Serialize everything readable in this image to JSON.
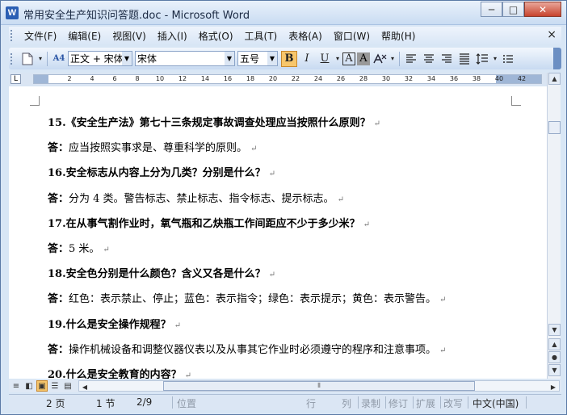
{
  "window": {
    "title": "常用安全生产知识问答题.doc - Microsoft Word",
    "icon_label": "W",
    "minimize": "─",
    "maximize": "□",
    "close": "✕"
  },
  "menu": {
    "items": [
      "文件(F)",
      "编辑(E)",
      "视图(V)",
      "插入(I)",
      "格式(O)",
      "工具(T)",
      "表格(A)",
      "窗口(W)",
      "帮助(H)"
    ],
    "close_doc": "×"
  },
  "toolbar": {
    "style_value": "正文 + 宋体",
    "font_value": "宋体",
    "size_value": "五号",
    "bold": "B",
    "italic": "I",
    "underline": "U",
    "style_icon": "A4",
    "char_border": "A",
    "char_shading": "A"
  },
  "ruler": {
    "corner": "L",
    "ticks": [
      "2",
      "4",
      "6",
      "8",
      "10",
      "12",
      "14",
      "16",
      "18",
      "20",
      "22",
      "24",
      "26",
      "28",
      "30",
      "32",
      "34",
      "36",
      "38",
      "40",
      "42"
    ]
  },
  "document": {
    "lines": [
      {
        "type": "q",
        "text": "15.《安全生产法》第七十三条规定事故调查处理应当按照什么原则？"
      },
      {
        "type": "a",
        "label": "答：",
        "text": "应当按照实事求是、尊重科学的原则。"
      },
      {
        "type": "q",
        "text": "16.安全标志从内容上分为几类？分别是什么？"
      },
      {
        "type": "a",
        "label": "答：",
        "text": "分为 4 类。警告标志、禁止标志、指令标志、提示标志。"
      },
      {
        "type": "q",
        "text": "17.在从事气割作业时，氧气瓶和乙炔瓶工作间距应不少于多少米？"
      },
      {
        "type": "a",
        "label": "答：",
        "text": "5 米。"
      },
      {
        "type": "q",
        "text": "18.安全色分别是什么颜色？含义又各是什么？"
      },
      {
        "type": "a",
        "label": "答：",
        "text": "红色：表示禁止、停止；蓝色：表示指令；绿色：表示提示；黄色：表示警告。"
      },
      {
        "type": "q",
        "text": "19.什么是安全操作规程？"
      },
      {
        "type": "a",
        "label": "答：",
        "text": "操作机械设备和调整仪器仪表以及从事其它作业时必须遵守的程序和注意事项。"
      },
      {
        "type": "q",
        "text": "20.什么是安全教育的内容？"
      }
    ],
    "paragraph_mark": "↵"
  },
  "status": {
    "page": "2 页",
    "section": "1 节",
    "page_of": "2/9",
    "position": "位置",
    "line": "行",
    "column": "列",
    "rec": "录制",
    "trk": "修订",
    "ext": "扩展",
    "ovr": "改写",
    "language": "中文(中国)"
  }
}
